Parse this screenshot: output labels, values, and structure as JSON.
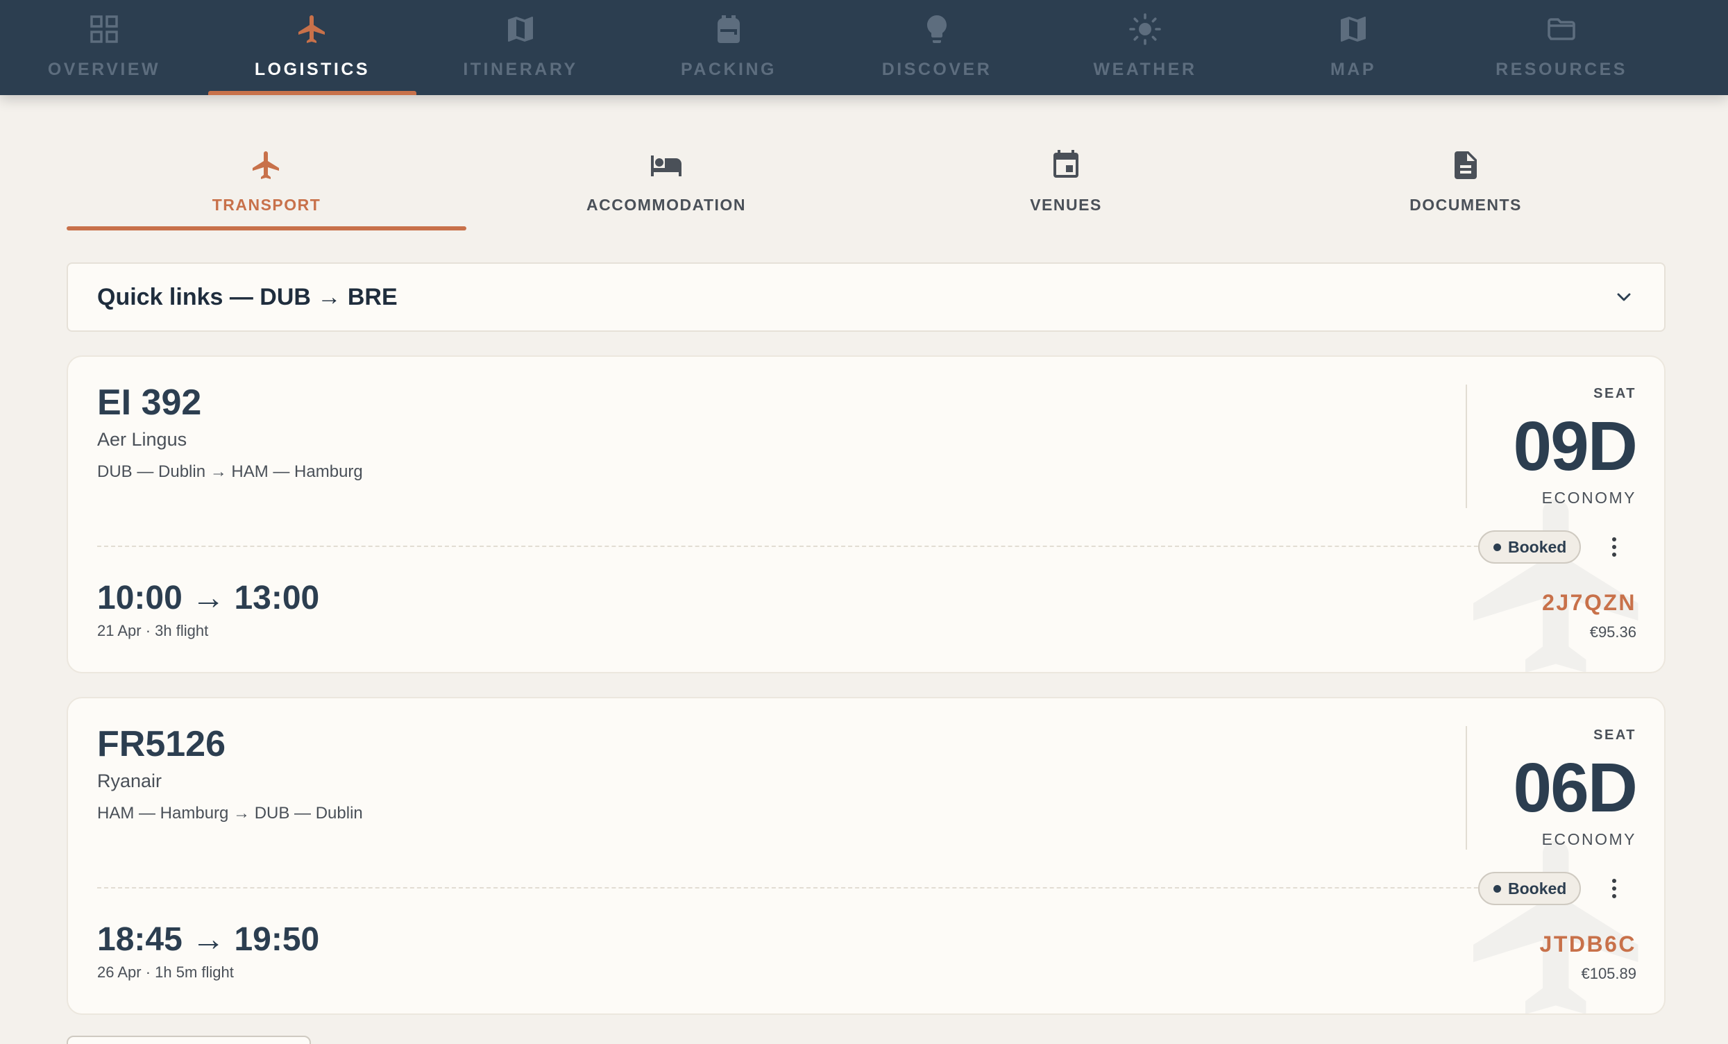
{
  "nav": {
    "items": [
      {
        "label": "OVERVIEW",
        "icon": "grid-icon",
        "active": false
      },
      {
        "label": "LOGISTICS",
        "icon": "airplane-icon",
        "active": true
      },
      {
        "label": "ITINERARY",
        "icon": "map-icon",
        "active": false
      },
      {
        "label": "PACKING",
        "icon": "backpack-icon",
        "active": false
      },
      {
        "label": "DISCOVER",
        "icon": "lightbulb-icon",
        "active": false
      },
      {
        "label": "WEATHER",
        "icon": "sun-icon",
        "active": false
      },
      {
        "label": "MAP",
        "icon": "map-icon",
        "active": false
      },
      {
        "label": "RESOURCES",
        "icon": "folder-icon",
        "active": false
      }
    ]
  },
  "subtabs": {
    "items": [
      {
        "label": "TRANSPORT",
        "icon": "airplane-icon",
        "active": true
      },
      {
        "label": "ACCOMMODATION",
        "icon": "bed-icon",
        "active": false
      },
      {
        "label": "VENUES",
        "icon": "calendar-icon",
        "active": false
      },
      {
        "label": "DOCUMENTS",
        "icon": "document-icon",
        "active": false
      }
    ]
  },
  "quicklinks": {
    "title": "Quick links — DUB → BRE",
    "icon": "chevron-down-icon"
  },
  "flights": [
    {
      "flight_no": "EI 392",
      "airline": "Aer Lingus",
      "route": "DUB — Dublin → HAM — Hamburg",
      "seat_label": "SEAT",
      "seat": "09D",
      "cabin": "ECONOMY",
      "status": "Booked",
      "times": "10:00 → 13:00",
      "meta": "21 Apr · 3h flight",
      "pnr": "2J7QZN",
      "price": "€95.36"
    },
    {
      "flight_no": "FR5126",
      "airline": "Ryanair",
      "route": "HAM — Hamburg → DUB — Dublin",
      "seat_label": "SEAT",
      "seat": "06D",
      "cabin": "ECONOMY",
      "status": "Booked",
      "times": "18:45 → 19:50",
      "meta": "26 Apr · 1h 5m flight",
      "pnr": "JTDB6C",
      "price": "€105.89"
    }
  ],
  "colors": {
    "nav_bg": "#2c3e50",
    "accent": "#c8714a",
    "page_bg": "#f4f1ec",
    "card_bg": "#fdfbf7"
  }
}
